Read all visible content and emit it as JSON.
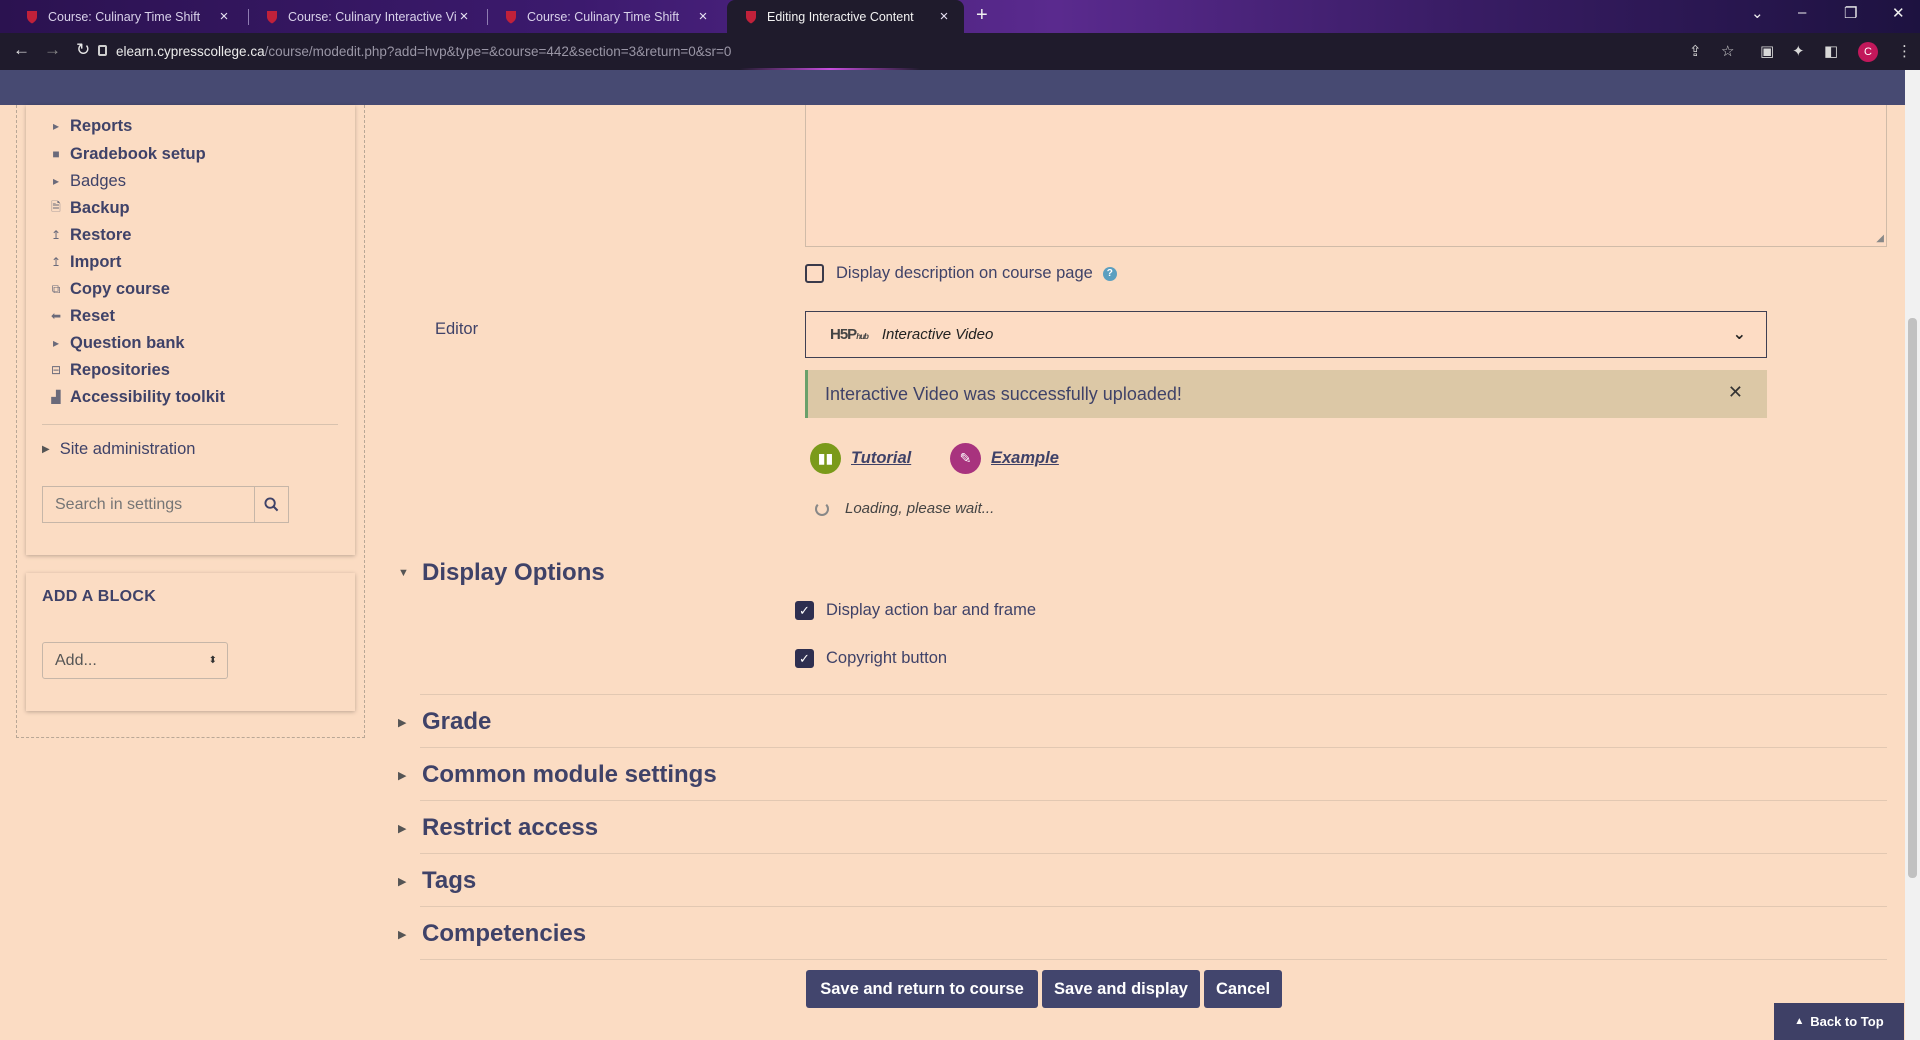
{
  "browser": {
    "tabs": [
      {
        "title": "Course: Culinary Time Shift",
        "active": false
      },
      {
        "title": "Course: Culinary Interactive Vide",
        "active": false
      },
      {
        "title": "Course: Culinary Time Shift",
        "active": false
      },
      {
        "title": "Editing Interactive Content",
        "active": true
      }
    ],
    "url_host": "elearn.cypresscollege.ca",
    "url_path": "/course/modedit.php?add=hvp&type=&course=442&section=3&return=0&sr=0",
    "profile_initial": "C"
  },
  "sidebar": {
    "items": [
      {
        "label": "Reports",
        "icon": "caret-right-icon",
        "bold": true
      },
      {
        "label": "Gradebook setup",
        "icon": "bullet-icon",
        "bold": true
      },
      {
        "label": "Badges",
        "icon": "caret-right-icon",
        "bold": false
      },
      {
        "label": "Backup",
        "icon": "file-icon",
        "bold": true
      },
      {
        "label": "Restore",
        "icon": "upload-icon",
        "bold": true
      },
      {
        "label": "Import",
        "icon": "upload-icon",
        "bold": true
      },
      {
        "label": "Copy course",
        "icon": "copy-icon",
        "bold": true
      },
      {
        "label": "Reset",
        "icon": "arrow-left-icon",
        "bold": true
      },
      {
        "label": "Question bank",
        "icon": "caret-right-icon",
        "bold": true
      },
      {
        "label": "Repositories",
        "icon": "drive-icon",
        "bold": true
      },
      {
        "label": "Accessibility toolkit",
        "icon": "chart-icon",
        "bold": true
      }
    ],
    "site_admin": "Site administration",
    "search_placeholder": "Search in settings",
    "add_block": {
      "title": "ADD A BLOCK",
      "select_value": "Add..."
    }
  },
  "form": {
    "display_description": {
      "label": "Display description on course page",
      "checked": false
    },
    "editor_label": "Editor",
    "editor_logo": "H5P",
    "editor_logo_sub": "hub",
    "editor_content_type": "Interactive Video",
    "alert_text": "Interactive Video was successfully uploaded!",
    "tutorial_label": "Tutorial",
    "example_label": "Example",
    "loading_text": "Loading, please wait...",
    "display_options": {
      "title": "Display Options",
      "action_bar": {
        "label": "Display action bar and frame",
        "checked": true
      },
      "copyright": {
        "label": "Copyright button",
        "checked": true
      }
    },
    "collapsed_sections": [
      "Grade",
      "Common module settings",
      "Restrict access",
      "Tags",
      "Competencies"
    ],
    "buttons": {
      "save_return": "Save and return to course",
      "save_display": "Save and display",
      "cancel": "Cancel"
    },
    "back_to_top": "Back to Top"
  },
  "colors": {
    "page_bg": "#fbdcc3",
    "accent": "#42456d",
    "alert_bg": "#dcc8a6",
    "tutorial_green": "#7a9a1a",
    "example_magenta": "#a8337e"
  }
}
